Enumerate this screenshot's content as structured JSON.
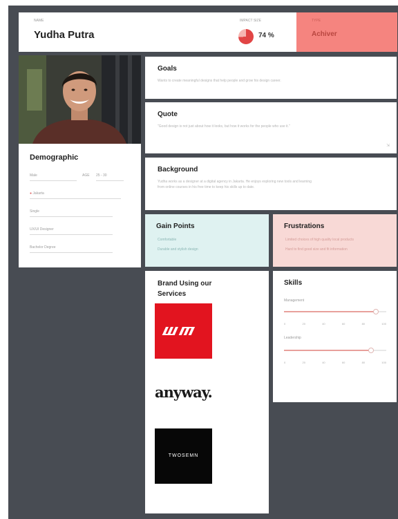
{
  "header": {
    "name_label": "NAME",
    "name": "Yudha Putra",
    "impact_label": "IMPACT SIZE",
    "impact_value": "74 %",
    "impact_fraction": 0.74,
    "type_label": "TYPE",
    "type_value": "Achiver"
  },
  "demographic": {
    "title": "Demographic",
    "gender": "Male",
    "age_label": "AGE",
    "age": "25 - 30",
    "location": "Jakarta",
    "status": "Single",
    "occupation": "UX/UI Designer",
    "education": "Bachelor Degree"
  },
  "goals": {
    "title": "Goals",
    "text": "Wants to create meaningful designs that help people and grow his design career."
  },
  "quote": {
    "title": "Quote",
    "text": "\"Good design is not just about how it looks, but how it works for the people who use it.\""
  },
  "background": {
    "title": "Background",
    "line1": "Yudha works as a designer at a digital agency in Jakarta. He enjoys exploring new tools and learning",
    "line2": "from online courses in his free time to keep his skills up to date."
  },
  "gain_points": {
    "title": "Gain Points",
    "items": [
      "Comfortable",
      "Durable and stylish design"
    ]
  },
  "frustrations": {
    "title": "Frustrations",
    "items": [
      "Limited choices of high quality local products",
      "Hard to find good size and fit information"
    ]
  },
  "brands": {
    "title": "Brand Using our Services",
    "logos": [
      "WM",
      "anyway.",
      "TWOSEMN"
    ]
  },
  "skills": {
    "title": "Skills",
    "ticks": [
      "0",
      "20",
      "40",
      "60",
      "80",
      "100"
    ],
    "items": [
      {
        "label": "Management",
        "value": 0.9
      },
      {
        "label": "Leadership",
        "value": 0.85
      }
    ]
  },
  "colors": {
    "type_bg": "#f5847f",
    "gain_bg": "#dff2f1",
    "frustration_bg": "#f8d9d6",
    "impact_pie": "#e14545",
    "canvas": "#484c53"
  }
}
